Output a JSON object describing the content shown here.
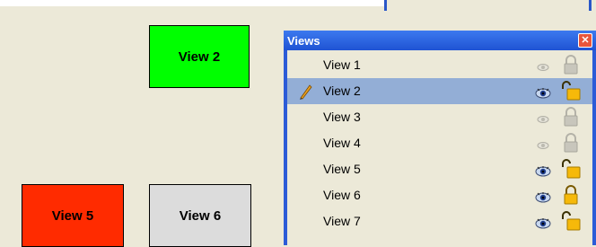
{
  "canvas_views": {
    "view2": "View  2",
    "view5": "View  5",
    "view6": "View  6"
  },
  "panel": {
    "title": "Views",
    "close_icon": "close-icon",
    "rows": [
      {
        "label": "View 1",
        "visible": false,
        "locked": true,
        "editing": false,
        "selected": false
      },
      {
        "label": "View 2",
        "visible": true,
        "locked": false,
        "editing": true,
        "selected": true
      },
      {
        "label": "View 3",
        "visible": false,
        "locked": true,
        "editing": false,
        "selected": false
      },
      {
        "label": "View 4",
        "visible": false,
        "locked": true,
        "editing": false,
        "selected": false
      },
      {
        "label": "View 5",
        "visible": true,
        "locked": false,
        "editing": false,
        "selected": false
      },
      {
        "label": "View 6",
        "visible": true,
        "locked": true,
        "editing": false,
        "selected": false
      },
      {
        "label": "View 7",
        "visible": true,
        "locked": false,
        "editing": false,
        "selected": false
      }
    ]
  },
  "colors": {
    "view2": "#00ff00",
    "view5": "#ff2b00",
    "view6": "#dcdcdc",
    "selection": "#93aed6",
    "panel_frame": "#2c5bd7"
  }
}
